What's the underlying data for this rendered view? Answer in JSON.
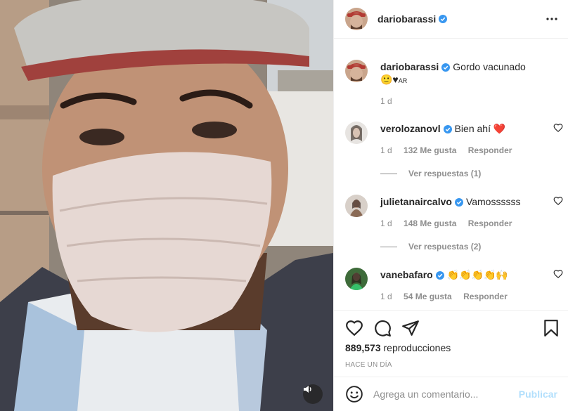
{
  "post": {
    "author": "dariobarassi",
    "caption": "Gordo vacunado",
    "caption_emoji": "🙂♥",
    "caption_suffix": "AR",
    "time": "1 d"
  },
  "comments": [
    {
      "user": "verolozanovl",
      "text": "Bien ahí",
      "emoji": "❤️",
      "time": "1 d",
      "likes": "132 Me gusta",
      "reply": "Responder",
      "replies": "Ver respuestas (1)"
    },
    {
      "user": "julietanaircalvo",
      "text": "Vamossssss",
      "emoji": "",
      "time": "1 d",
      "likes": "148 Me gusta",
      "reply": "Responder",
      "replies": "Ver respuestas (2)"
    },
    {
      "user": "vanebafaro",
      "text": "",
      "emoji": "👏👏👏👏🙌",
      "time": "1 d",
      "likes": "54 Me gusta",
      "reply": "Responder",
      "replies": ""
    }
  ],
  "stats": {
    "views": "889,573",
    "views_label": "reproducciones",
    "posted": "HACE UN DÍA"
  },
  "add_comment": {
    "placeholder": "Agrega un comentario...",
    "publish": "Publicar"
  },
  "icons": {
    "like": "heart-icon",
    "comment": "comment-icon",
    "share": "send-icon",
    "save": "bookmark-icon",
    "more": "more-icon",
    "sound": "speaker-icon",
    "emoji": "smiley-icon",
    "verified": "verified-badge-icon"
  },
  "colors": {
    "verified": "#3897f0",
    "heart_red": "#e0245e",
    "publish_disabled": "#b2dffc",
    "meta": "#8e8e8e"
  }
}
